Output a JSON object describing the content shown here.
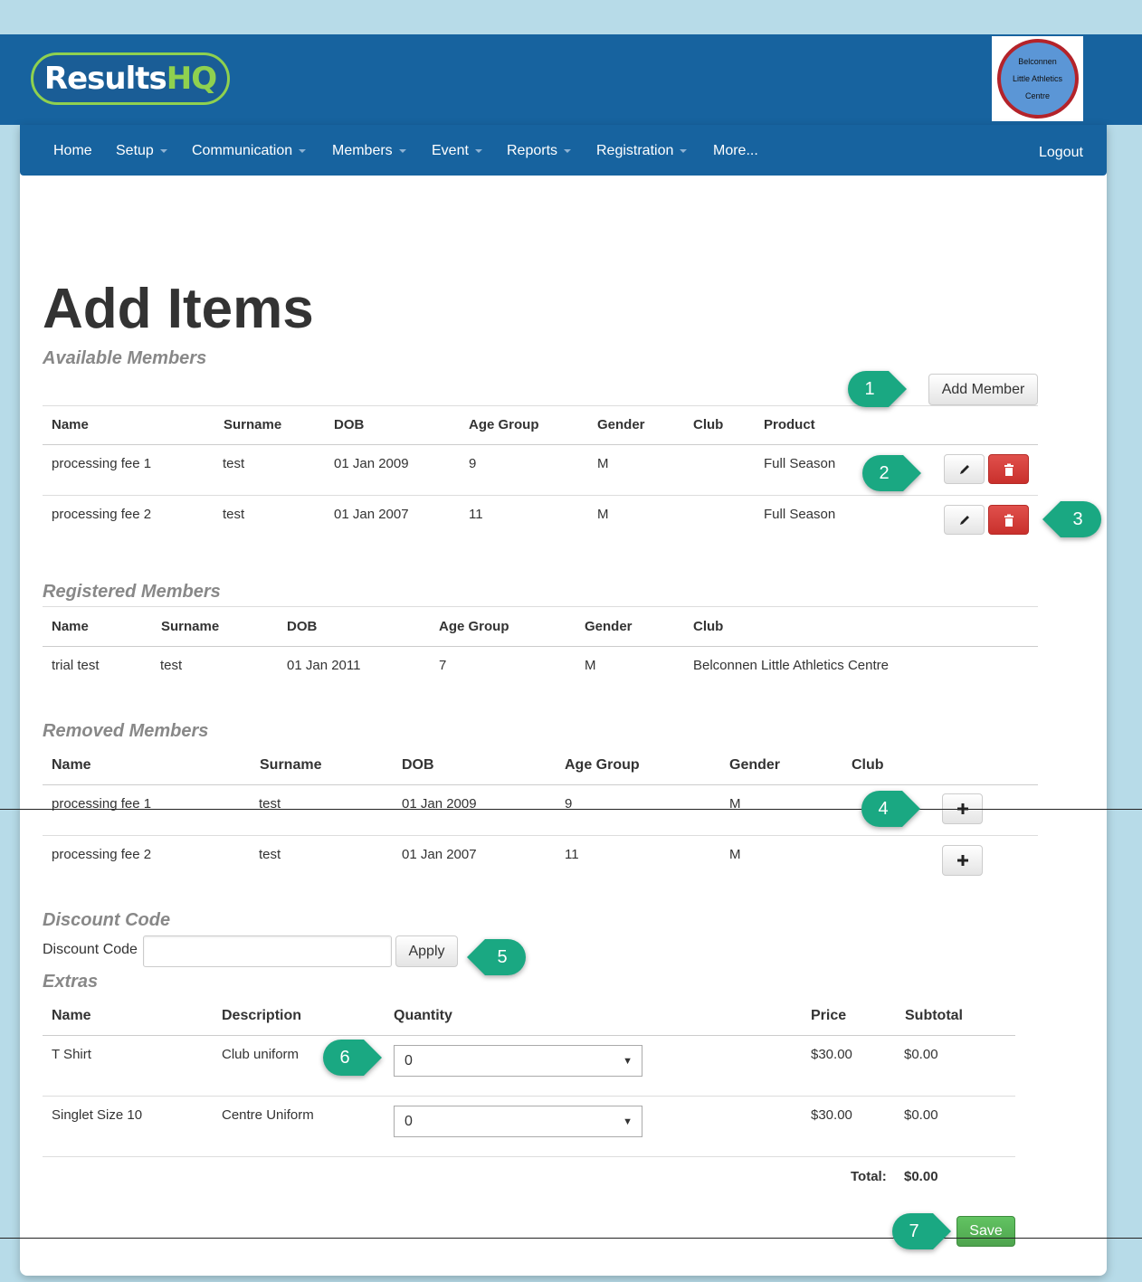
{
  "header": {
    "logo": {
      "part1": "Results",
      "part2": "HQ"
    },
    "club_logo": {
      "line1": "Belconnen",
      "line2": "Little Athletics",
      "line3": "Centre"
    }
  },
  "nav": {
    "items": [
      "Home",
      "Setup",
      "Communication",
      "Members",
      "Event",
      "Reports",
      "Registration",
      "More..."
    ],
    "logout": "Logout"
  },
  "page_title": "Add Items",
  "available": {
    "title": "Available Members",
    "add_button": "Add Member",
    "columns": [
      "Name",
      "Surname",
      "DOB",
      "Age Group",
      "Gender",
      "Club",
      "Product"
    ],
    "rows": [
      {
        "name": "processing fee 1",
        "surname": "test",
        "dob": "01 Jan 2009",
        "age_group": "9",
        "gender": "M",
        "club": "",
        "product": "Full Season"
      },
      {
        "name": "processing fee 2",
        "surname": "test",
        "dob": "01 Jan 2007",
        "age_group": "11",
        "gender": "M",
        "club": "",
        "product": "Full Season"
      }
    ]
  },
  "registered": {
    "title": "Registered Members",
    "columns": [
      "Name",
      "Surname",
      "DOB",
      "Age Group",
      "Gender",
      "Club"
    ],
    "rows": [
      {
        "name": "trial test",
        "surname": "test",
        "dob": "01 Jan 2011",
        "age_group": "7",
        "gender": "M",
        "club": "Belconnen Little Athletics Centre"
      }
    ]
  },
  "removed": {
    "title": "Removed Members",
    "columns": [
      "Name",
      "Surname",
      "DOB",
      "Age Group",
      "Gender",
      "Club"
    ],
    "rows": [
      {
        "name": "processing fee 1",
        "surname": "test",
        "dob": "01 Jan 2009",
        "age_group": "9",
        "gender": "M",
        "club": ""
      },
      {
        "name": "processing fee 2",
        "surname": "test",
        "dob": "01 Jan 2007",
        "age_group": "11",
        "gender": "M",
        "club": ""
      }
    ]
  },
  "discount": {
    "title": "Discount Code",
    "label": "Discount Code",
    "value": "",
    "apply": "Apply"
  },
  "extras": {
    "title": "Extras",
    "columns": [
      "Name",
      "Description",
      "Quantity",
      "Price",
      "Subtotal"
    ],
    "rows": [
      {
        "name": "T Shirt",
        "description": "Club uniform",
        "quantity": "0",
        "price": "$30.00",
        "subtotal": "$0.00"
      },
      {
        "name": "Singlet Size 10",
        "description": "Centre Uniform",
        "quantity": "0",
        "price": "$30.00",
        "subtotal": "$0.00"
      }
    ],
    "total_label": "Total:",
    "total_value": "$0.00"
  },
  "save": "Save",
  "callouts": [
    "1",
    "2",
    "3",
    "4",
    "5",
    "6",
    "7"
  ],
  "icons": {
    "edit": "pencil-icon",
    "delete": "trash-icon",
    "add": "plus-icon",
    "dropdown": "chevron-down-icon"
  },
  "colors": {
    "brand": "#17639f",
    "accent": "#8fd14f",
    "danger": "#c9302c",
    "success": "#4ea44e",
    "callout": "#1aa882"
  }
}
